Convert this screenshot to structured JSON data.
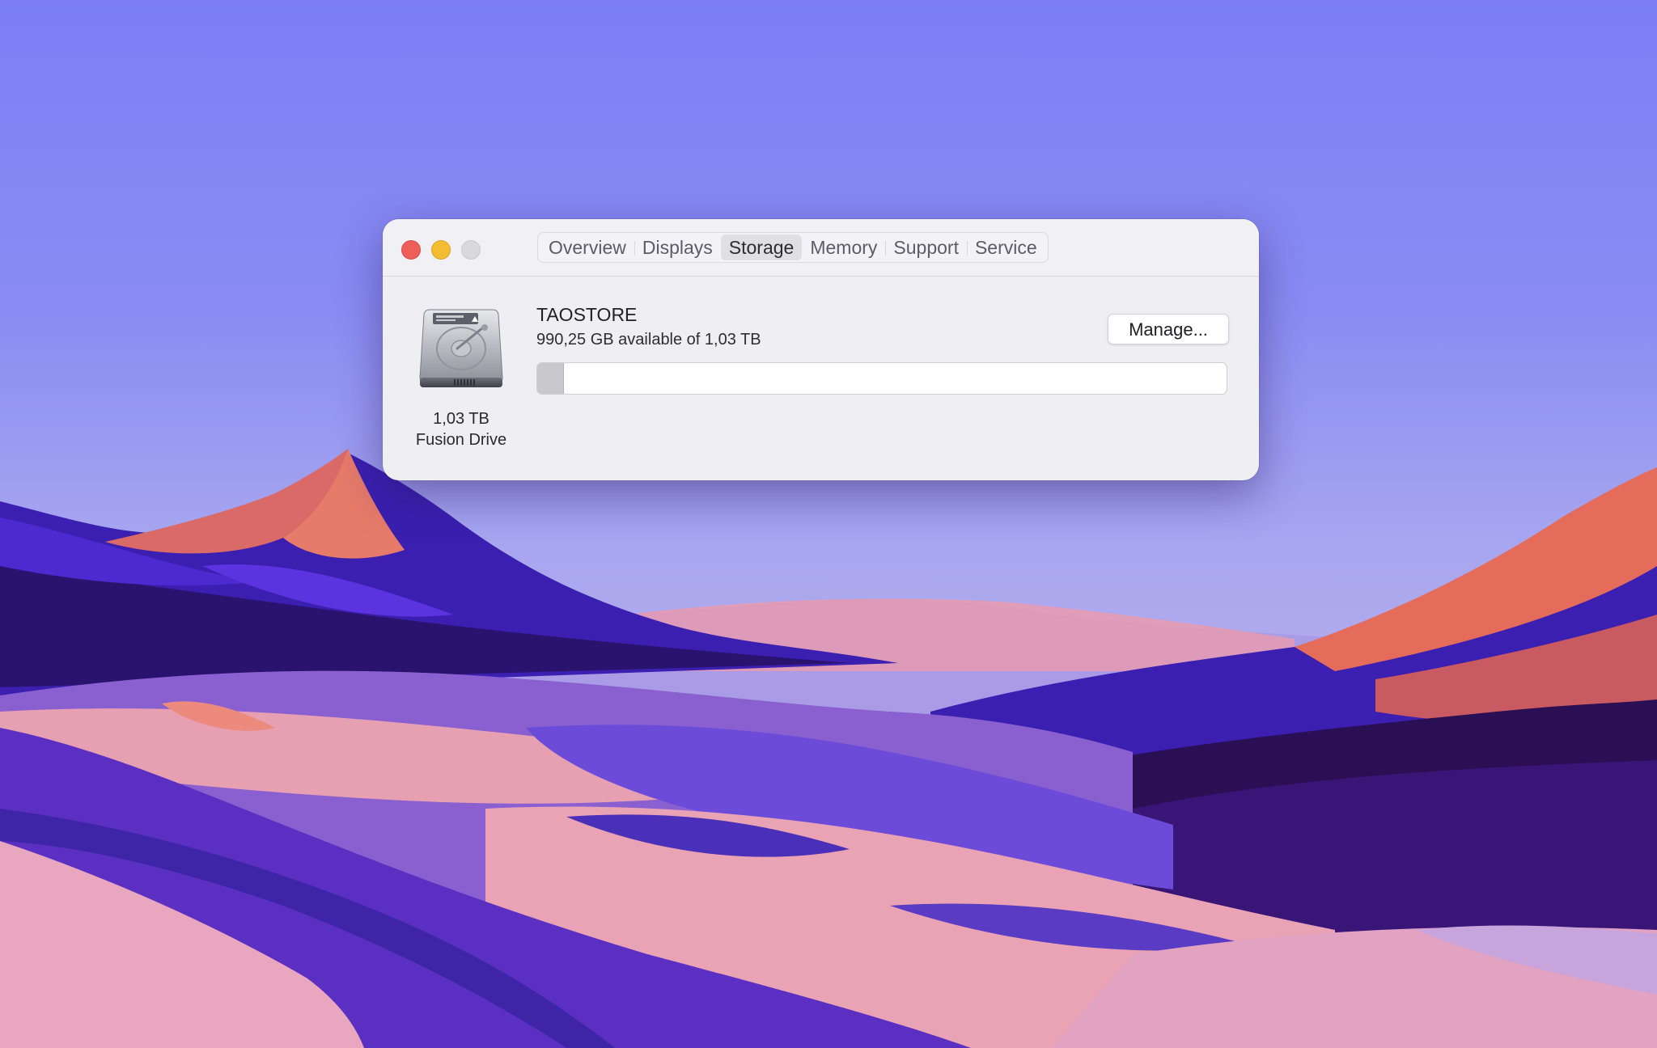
{
  "window": {
    "tabs": [
      {
        "label": "Overview"
      },
      {
        "label": "Displays"
      },
      {
        "label": "Storage"
      },
      {
        "label": "Memory"
      },
      {
        "label": "Support"
      },
      {
        "label": "Service"
      }
    ],
    "active_tab": "Storage"
  },
  "drive": {
    "size": "1,03 TB",
    "type": "Fusion Drive",
    "icon": "hard-drive-icon"
  },
  "volume": {
    "name": "TAOSTORE",
    "available_text": "990,25 GB available of 1,03 TB",
    "used_fraction": 0.039,
    "manage_label": "Manage..."
  },
  "colors": {
    "close": "#ed5f58",
    "minimize": "#f4bd31",
    "zoom": "#d9d8dc",
    "used_segment": "#c9c8cd"
  }
}
